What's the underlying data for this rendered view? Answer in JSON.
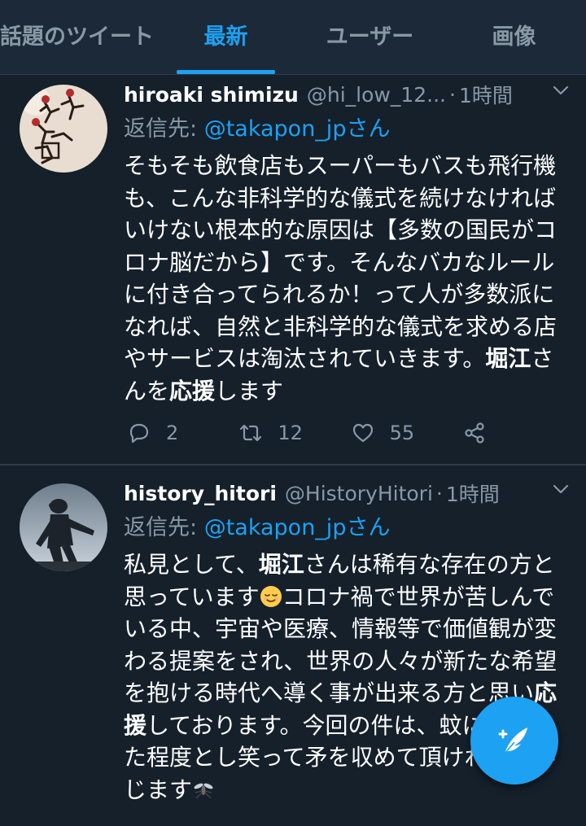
{
  "tabs": [
    {
      "label": "話題のツイート",
      "active": false
    },
    {
      "label": "最新",
      "active": true
    },
    {
      "label": "ユーザー",
      "active": false
    },
    {
      "label": "画像",
      "active": false
    }
  ],
  "tweets": [
    {
      "name": "hiroaki shimizu",
      "handle": "@hi_low_12...",
      "separator": "·",
      "time": "1時間",
      "reply_prefix": "返信先:",
      "reply_mention": "@takapon_jpさん",
      "body_segments": [
        {
          "text": "そもそも飲食店もスーパーもバスも飛行機も、こんな非科学的な儀式を続けなければいけない根本的な原因は【多数の国民がコロナ脳だから】です。そんなバカなルールに付き合ってられるか！って人が多数派になれば、自然と非科学的な儀式を求める店やサービスは淘汰されていきます。",
          "bold": false
        },
        {
          "text": "堀江",
          "bold": true
        },
        {
          "text": "さんを",
          "bold": false
        },
        {
          "text": "応援",
          "bold": true
        },
        {
          "text": "します",
          "bold": false
        }
      ],
      "replies": "2",
      "retweets": "12",
      "likes": "55"
    },
    {
      "name": "history_hitori",
      "handle": "@HistoryHitori",
      "separator": "·",
      "time": "1時間",
      "reply_prefix": "返信先:",
      "reply_mention": "@takapon_jpさん",
      "body_segments": [
        {
          "text": "私見として、",
          "bold": false
        },
        {
          "text": "堀江",
          "bold": true
        },
        {
          "text": "さんは稀有な存在の方と思っています",
          "bold": false
        },
        {
          "text": "コロナ禍で世界が苦しんでいる中、宇宙や医療、情報等で価値観が変わる提案をされ、世界の人々が新たな希望を抱ける時代へ導く事が出来る方と思い",
          "bold": false
        },
        {
          "text": "応援",
          "bold": true
        },
        {
          "text": "しております。今回の件は、蚊に刺された程度とし笑って矛を収めて頂ければと存じます",
          "bold": false
        }
      ]
    }
  ],
  "icons": {
    "chevron": "chevron-down-icon",
    "reply": "reply-icon",
    "retweet": "retweet-icon",
    "like": "heart-icon",
    "share": "share-icon",
    "compose": "compose-feather-icon",
    "emoji_relieved": "relieved-face-emoji",
    "emoji_mosquito": "mosquito-emoji"
  },
  "colors": {
    "background": "#15202b",
    "tab_bar": "#1c2938",
    "accent": "#1da1f2",
    "secondary_text": "#8899a6"
  }
}
